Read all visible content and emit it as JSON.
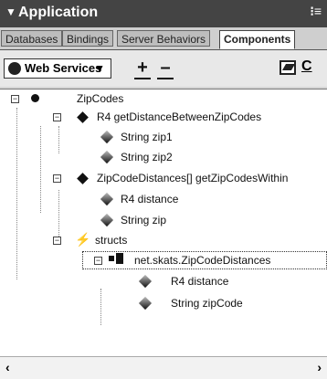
{
  "window": {
    "title": "Application"
  },
  "tabs": [
    {
      "label": "Databases",
      "active": false
    },
    {
      "label": "Bindings",
      "active": false
    },
    {
      "label": "Server Behaviors",
      "active": false
    },
    {
      "label": "Components",
      "active": true
    }
  ],
  "toolbar": {
    "select_value": "Web Services",
    "add_label": "+",
    "remove_label": "–",
    "trailing_text": "C"
  },
  "tree": [
    {
      "label": "ZipCodes",
      "icon": "globe-icon"
    },
    {
      "label": "R4 getDistanceBetweenZipCodes",
      "icon": "method-icon"
    },
    {
      "label": "String zip1",
      "icon": "parameter-icon"
    },
    {
      "label": "String zip2",
      "icon": "parameter-icon"
    },
    {
      "label": "ZipCodeDistances[] getZipCodesWithin",
      "icon": "method-icon"
    },
    {
      "label": "R4 distance",
      "icon": "parameter-icon"
    },
    {
      "label": "String zip",
      "icon": "parameter-icon"
    },
    {
      "label": "structs",
      "icon": "struct-folder-icon"
    },
    {
      "label": "net.skats.ZipCodeDistances",
      "icon": "struct-icon"
    },
    {
      "label": "R4 distance",
      "icon": "parameter-icon"
    },
    {
      "label": "String zipCode",
      "icon": "parameter-icon"
    }
  ]
}
